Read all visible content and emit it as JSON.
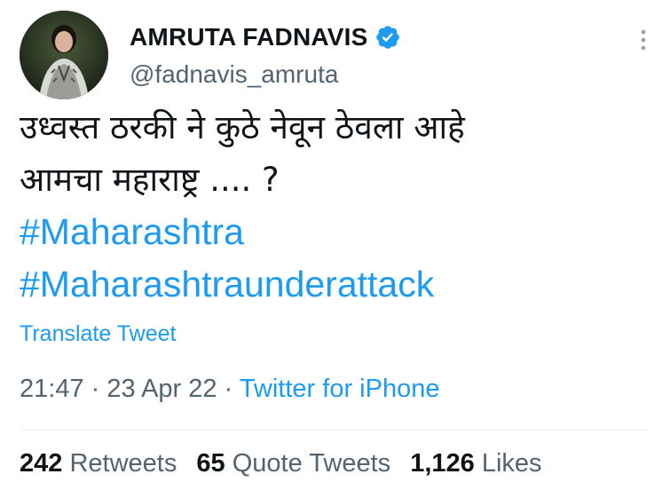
{
  "user": {
    "display_name": "AMRUTA FADNAVIS",
    "handle": "@fadnavis_amruta",
    "verified": true
  },
  "tweet": {
    "lines": [
      "उध्वस्त ठरकी ने कुठे नेवून ठेवला आहे",
      "आमचा महाराष्ट्र .... ?"
    ],
    "hashtags": [
      "#Maharashtra",
      "#Maharashtraunderattack"
    ],
    "translate_label": "Translate Tweet",
    "time": "21:47",
    "separator": "·",
    "date": "23 Apr 22",
    "source": "Twitter for iPhone"
  },
  "stats": {
    "retweets_count": "242",
    "retweets_label": "Retweets",
    "quotes_count": "65",
    "quotes_label": "Quote Tweets",
    "likes_count": "1,126",
    "likes_label": "Likes"
  },
  "colors": {
    "accent": "#1d9bf0",
    "secondary_text": "#536471",
    "primary_text": "#0f1419"
  },
  "icons": {
    "verified": "verified-badge-icon",
    "more": "more-vertical-icon"
  }
}
